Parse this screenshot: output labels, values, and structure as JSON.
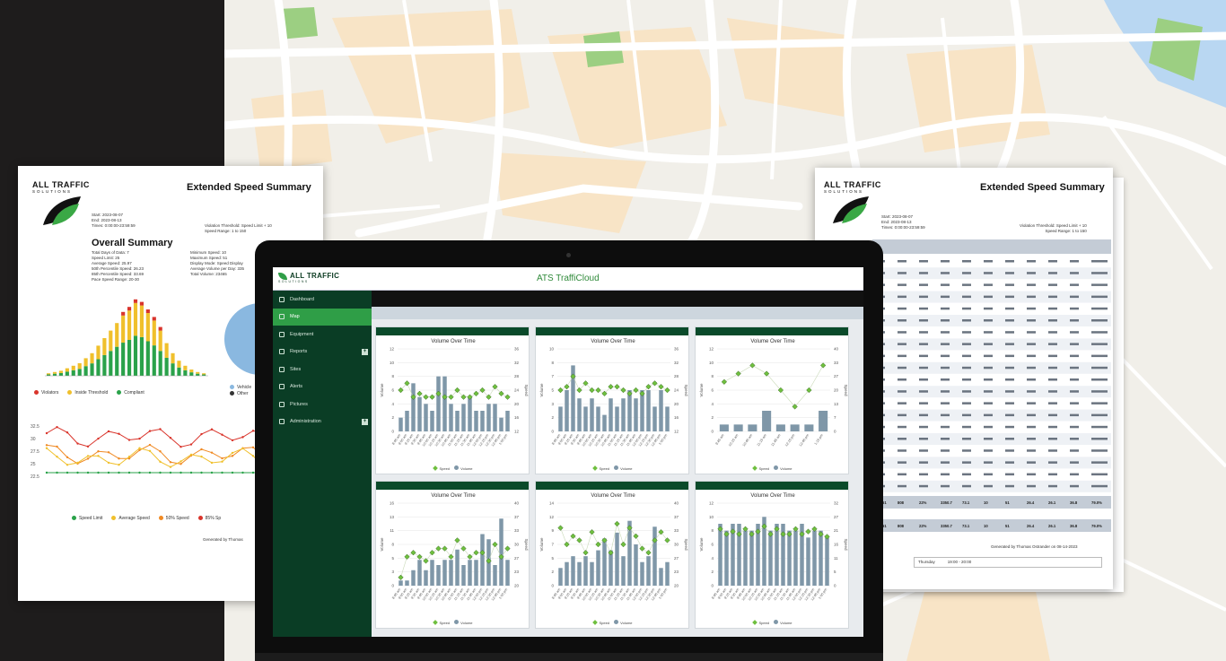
{
  "left_report": {
    "brand": "ALL TRAFFIC",
    "brand_sub": "SOLUTIONS",
    "title": "Extended Speed Summary",
    "meta_left": [
      "Start: 2023-08-07",
      "End: 2023-08-13",
      "Times: 0:00:00-23:59:59"
    ],
    "meta_right": [
      "Violation Threshold: Speed Limit + 10",
      "Speed Range: 1 to 150"
    ],
    "section_title": "Overall Summary",
    "stats_left": [
      "Total Days of Data: 7",
      "Speed Limit: 25",
      "Average Speed: 25.97",
      "50th Percentile Speed: 26.23",
      "85th Percentile Speed: 33.69",
      "Pace Speed Range: 20-30"
    ],
    "stats_right": [
      "Minimum Speed: 10",
      "Maximum Speed: 51",
      "Display Mode: Speed Display",
      "Average Volume per Day: 335",
      "Total Volume: 23465"
    ],
    "legend1": [
      "Violators",
      "Inside Threshold",
      "Compliant"
    ],
    "legend2": [
      "Speed Limit",
      "Average Speed",
      "50% Speed",
      "85% Sp"
    ],
    "pie_legend": [
      "Vehicle",
      "Other"
    ],
    "footer": "Generated by Thomas"
  },
  "right_report": {
    "brand": "ALL TRAFFIC",
    "brand_sub": "SOLUTIONS",
    "title": "Extended Speed Summary",
    "meta_left": [
      "Start: 2023-08-07",
      "End: 2023-08-13",
      "Times: 0:00:00-23:59:59"
    ],
    "meta_right": [
      "Violation Threshold: Speed Limit + 10",
      "Speed Range: 1 to 150"
    ],
    "footer": "Generated by Thomas Ostrander on 08-14-2023",
    "footer_day": "Thursday",
    "footer_time": "19:00 - 20:00",
    "summary_rows": [
      [
        "23461",
        "808",
        "22%",
        "3350.7",
        "73.1",
        "10",
        "51",
        "26.4",
        "26.1",
        "36.8",
        "79.0%"
      ],
      [
        "23461",
        "808",
        "22%",
        "3350.7",
        "73.1",
        "10",
        "51",
        "26.4",
        "26.1",
        "36.8",
        "79.0%"
      ]
    ]
  },
  "app": {
    "brand": "ALL TRAFFIC",
    "brand_sub": "SOLUTIONS",
    "title": "ATS TraffiCloud",
    "nav": [
      {
        "label": "Dashboard",
        "active": false,
        "expandable": false
      },
      {
        "label": "Map",
        "active": true,
        "expandable": false
      },
      {
        "label": "Equipment",
        "active": false,
        "expandable": false
      },
      {
        "label": "Reports",
        "active": false,
        "expandable": true
      },
      {
        "label": "Sites",
        "active": false,
        "expandable": false
      },
      {
        "label": "Alerts",
        "active": false,
        "expandable": false
      },
      {
        "label": "Pictures",
        "active": false,
        "expandable": false
      },
      {
        "label": "Administration",
        "active": false,
        "expandable": true
      }
    ],
    "panels": [
      {
        "title": "Volume Over Time",
        "legend": [
          "Speed",
          "Volume"
        ]
      },
      {
        "title": "Volume Over Time",
        "legend": [
          "Speed",
          "Volume"
        ]
      },
      {
        "title": "Volume Over Time",
        "legend": [
          "Speed",
          "Volume"
        ]
      },
      {
        "title": "Volume Over Time",
        "legend": [
          "Speed",
          "Volume"
        ]
      },
      {
        "title": "Volume Over Time",
        "legend": [
          "Speed",
          "Volume"
        ]
      },
      {
        "title": "Volume Over Time",
        "legend": [
          "Speed",
          "Volume"
        ]
      }
    ]
  },
  "chart_data": [
    {
      "type": "bar",
      "title": "Volume Over Time",
      "ylabel": "Volume",
      "y2label": "Speed",
      "ylim": [
        0,
        12
      ],
      "y2lim": [
        12,
        36
      ],
      "categories": [
        "8:45 am",
        "9:00 am",
        "9:15 am",
        "9:30 am",
        "9:45 am",
        "10:00 am",
        "10:15 am",
        "10:30 am",
        "10:45 am",
        "11:00 am",
        "11:15 am",
        "11:30 am",
        "11:45 am",
        "12:00 pm",
        "12:15 pm",
        "12:30 pm",
        "12:45 pm",
        "1:00 pm"
      ],
      "series": [
        {
          "name": "Volume",
          "values": [
            2,
            3,
            7,
            5,
            4,
            3,
            8,
            8,
            4,
            3,
            4,
            5,
            3,
            3,
            4,
            4,
            2,
            3
          ]
        },
        {
          "name": "Speed",
          "values": [
            24,
            26,
            22,
            23,
            22,
            22,
            23,
            22,
            22,
            24,
            22,
            22,
            23,
            24,
            22,
            25,
            23,
            22
          ]
        }
      ]
    },
    {
      "type": "bar",
      "title": "Volume Over Time",
      "ylabel": "Volume",
      "y2label": "Speed",
      "ylim": [
        0,
        10
      ],
      "y2lim": [
        12,
        36
      ],
      "categories": [
        "8:45 am",
        "9:00 am",
        "9:15 am",
        "9:30 am",
        "9:45 am",
        "10:00 am",
        "10:15 am",
        "10:30 am",
        "10:45 am",
        "11:00 am",
        "11:15 am",
        "11:30 am",
        "11:45 am",
        "12:00 pm",
        "12:15 pm",
        "12:30 pm",
        "12:45 pm",
        "1:00 pm"
      ],
      "series": [
        {
          "name": "Volume",
          "values": [
            3,
            5,
            8,
            4,
            3,
            4,
            3,
            2,
            4,
            3,
            4,
            5,
            4,
            5,
            5,
            3,
            5,
            3
          ]
        },
        {
          "name": "Speed",
          "values": [
            24,
            25,
            28,
            24,
            26,
            24,
            24,
            23,
            25,
            25,
            24,
            23,
            24,
            23,
            25,
            26,
            25,
            24
          ]
        }
      ]
    },
    {
      "type": "bar",
      "title": "Volume Over Time",
      "ylabel": "Volume",
      "y2label": "Speed",
      "ylim": [
        0,
        12
      ],
      "y2lim": [
        0,
        40
      ],
      "categories": [
        "9:45 am",
        "10:15 am",
        "10:45 am",
        "11:15 am",
        "11:45 am",
        "12:15 pm",
        "12:45 pm",
        "1:15 pm"
      ],
      "series": [
        {
          "name": "Volume",
          "values": [
            1,
            1,
            1,
            3,
            1,
            1,
            1,
            3
          ]
        },
        {
          "name": "Speed",
          "values": [
            24,
            28,
            32,
            28,
            20,
            12,
            20,
            32
          ]
        }
      ]
    },
    {
      "type": "bar",
      "title": "Volume Over Time",
      "ylabel": "Volume",
      "y2label": "Speed",
      "ylim": [
        0,
        16
      ],
      "y2lim": [
        20,
        40
      ],
      "categories": [
        "8:45 am",
        "9:00 am",
        "9:15 am",
        "9:30 am",
        "9:45 am",
        "10:00 am",
        "10:15 am",
        "10:30 am",
        "10:45 am",
        "11:00 am",
        "11:15 am",
        "11:30 am",
        "11:45 am",
        "12:00 pm",
        "12:15 pm",
        "12:30 pm",
        "12:45 pm",
        "1:00 pm"
      ],
      "series": [
        {
          "name": "Volume",
          "values": [
            1,
            1,
            3,
            5,
            3,
            5,
            4,
            5,
            5,
            7,
            4,
            5,
            5,
            10,
            9,
            4,
            13,
            5
          ]
        },
        {
          "name": "Speed",
          "values": [
            22,
            27,
            28,
            27,
            26,
            28,
            29,
            29,
            27,
            31,
            29,
            27,
            28,
            28,
            26,
            30,
            27,
            29
          ]
        }
      ]
    },
    {
      "type": "bar",
      "title": "Volume Over Time",
      "ylabel": "Volume",
      "y2label": "Speed",
      "ylim": [
        0,
        14
      ],
      "y2lim": [
        20,
        40
      ],
      "categories": [
        "8:45 am",
        "9:00 am",
        "9:15 am",
        "9:30 am",
        "9:45 am",
        "10:00 am",
        "10:15 am",
        "10:30 am",
        "10:45 am",
        "11:00 am",
        "11:15 am",
        "11:30 am",
        "11:45 am",
        "12:00 pm",
        "12:15 pm",
        "12:30 pm",
        "12:45 pm",
        "1:00 pm"
      ],
      "series": [
        {
          "name": "Volume",
          "values": [
            3,
            4,
            5,
            4,
            5,
            4,
            6,
            8,
            6,
            9,
            5,
            11,
            7,
            4,
            5,
            10,
            3,
            4
          ]
        },
        {
          "name": "Speed",
          "values": [
            34,
            30,
            32,
            31,
            28,
            33,
            30,
            31,
            28,
            35,
            30,
            34,
            32,
            29,
            28,
            31,
            33,
            31
          ]
        }
      ]
    },
    {
      "type": "bar",
      "title": "Volume Over Time",
      "ylabel": "Volume",
      "y2label": "Speed",
      "ylim": [
        0,
        12
      ],
      "y2lim": [
        0,
        32
      ],
      "categories": [
        "8:45 am",
        "9:00 am",
        "9:15 am",
        "9:30 am",
        "9:45 am",
        "10:00 am",
        "10:15 am",
        "10:30 am",
        "10:45 am",
        "11:00 am",
        "11:15 am",
        "11:30 am",
        "11:45 am",
        "12:00 pm",
        "12:15 pm",
        "12:30 pm",
        "12:45 pm",
        "1:00 pm"
      ],
      "series": [
        {
          "name": "Volume",
          "values": [
            9,
            8,
            9,
            9,
            8,
            8,
            9,
            10,
            8,
            9,
            9,
            8,
            8,
            9,
            7,
            8,
            8,
            7
          ]
        },
        {
          "name": "Speed",
          "values": [
            22,
            20,
            21,
            20,
            22,
            20,
            21,
            23,
            20,
            22,
            20,
            20,
            22,
            20,
            21,
            22,
            20,
            19
          ]
        }
      ]
    }
  ],
  "colors": {
    "brand_green": "#0a3d25",
    "accent_green": "#2f9e47",
    "bar": "#7f97a8",
    "speed_marker": "#6fbf3f"
  }
}
